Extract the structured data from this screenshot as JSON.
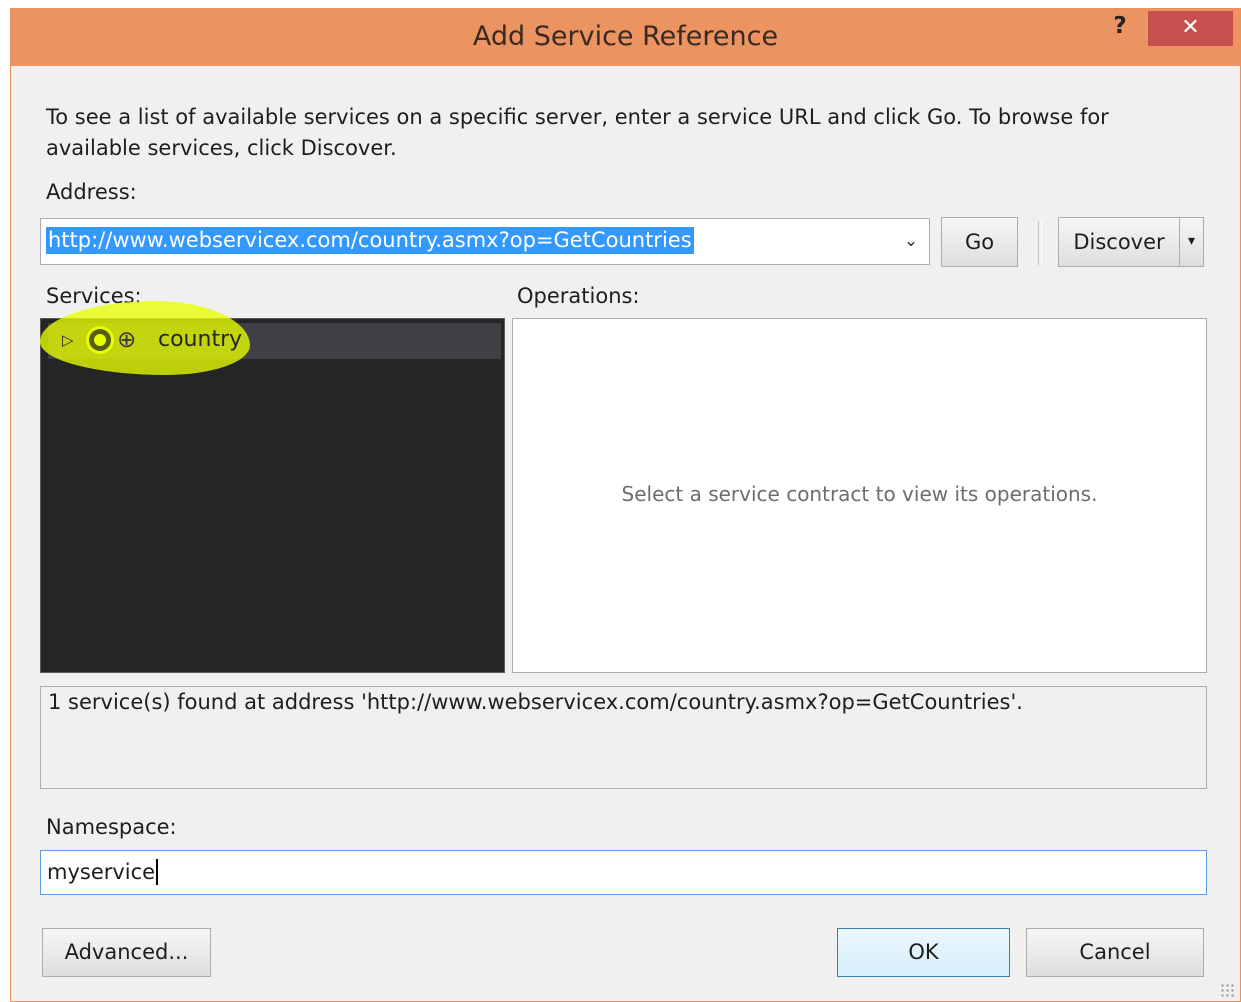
{
  "window": {
    "title": "Add Service Reference",
    "help_glyph": "?",
    "close_glyph": "✕"
  },
  "instructions": "To see a list of available services on a specific server, enter a service URL and click Go. To browse for available services, click Discover.",
  "address": {
    "label": "Address:",
    "value": "http://www.webservicex.com/country.asmx?op=GetCountries",
    "dropdown_glyph": "⌄"
  },
  "buttons": {
    "go": "Go",
    "discover": "Discover",
    "discover_split_glyph": "▾",
    "advanced": "Advanced...",
    "ok": "OK",
    "cancel": "Cancel"
  },
  "services": {
    "label": "Services:",
    "items": [
      {
        "label": "country",
        "expander_glyph": "▷",
        "icon": "service-reference-icon",
        "secondary_icon": "globe-icon",
        "globe_glyph": "⊕",
        "highlighted": true,
        "highlight_color": "#e8ff00"
      }
    ]
  },
  "operations": {
    "label": "Operations:",
    "empty_text": "Select a service contract to view its operations."
  },
  "status": {
    "text": "1 service(s) found at address 'http://www.webservicex.com/country.asmx?op=GetCountries'."
  },
  "namespace": {
    "label": "Namespace:",
    "value": "myservice"
  },
  "colors": {
    "titlebar": "#eb9461",
    "close_button": "#c7504f",
    "selection": "#3399ff",
    "tree_background": "#252526",
    "highlight": "#e8ff00"
  }
}
